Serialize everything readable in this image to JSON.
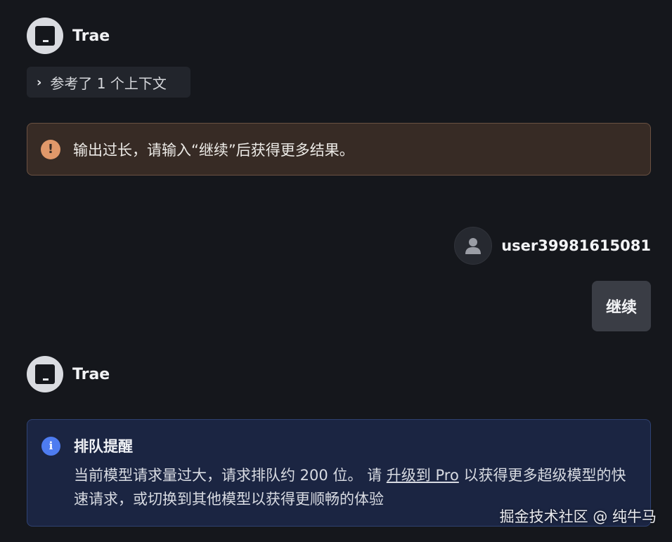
{
  "bot": {
    "name": "Trae"
  },
  "context_chip": {
    "chevron": "›",
    "label": "参考了 1 个上下文"
  },
  "warning": {
    "icon": "!",
    "text": "输出过长，请输入“继续”后获得更多结果。"
  },
  "user": {
    "name": "user39981615081",
    "message": "继续"
  },
  "queue_notice": {
    "icon": "i",
    "title": "排队提醒",
    "text_before": "当前模型请求量过大，请求排队约 200 位。 请 ",
    "link": "升级到 Pro",
    "text_after": " 以获得更多超级模型的快速请求，或切换到其他模型以获得更顺畅的体验"
  },
  "watermark": "掘金技术社区 @ 纯牛马",
  "colors": {
    "warning_accent": "#e0986a",
    "info_accent": "#4e7cf0",
    "background": "#15171c"
  }
}
